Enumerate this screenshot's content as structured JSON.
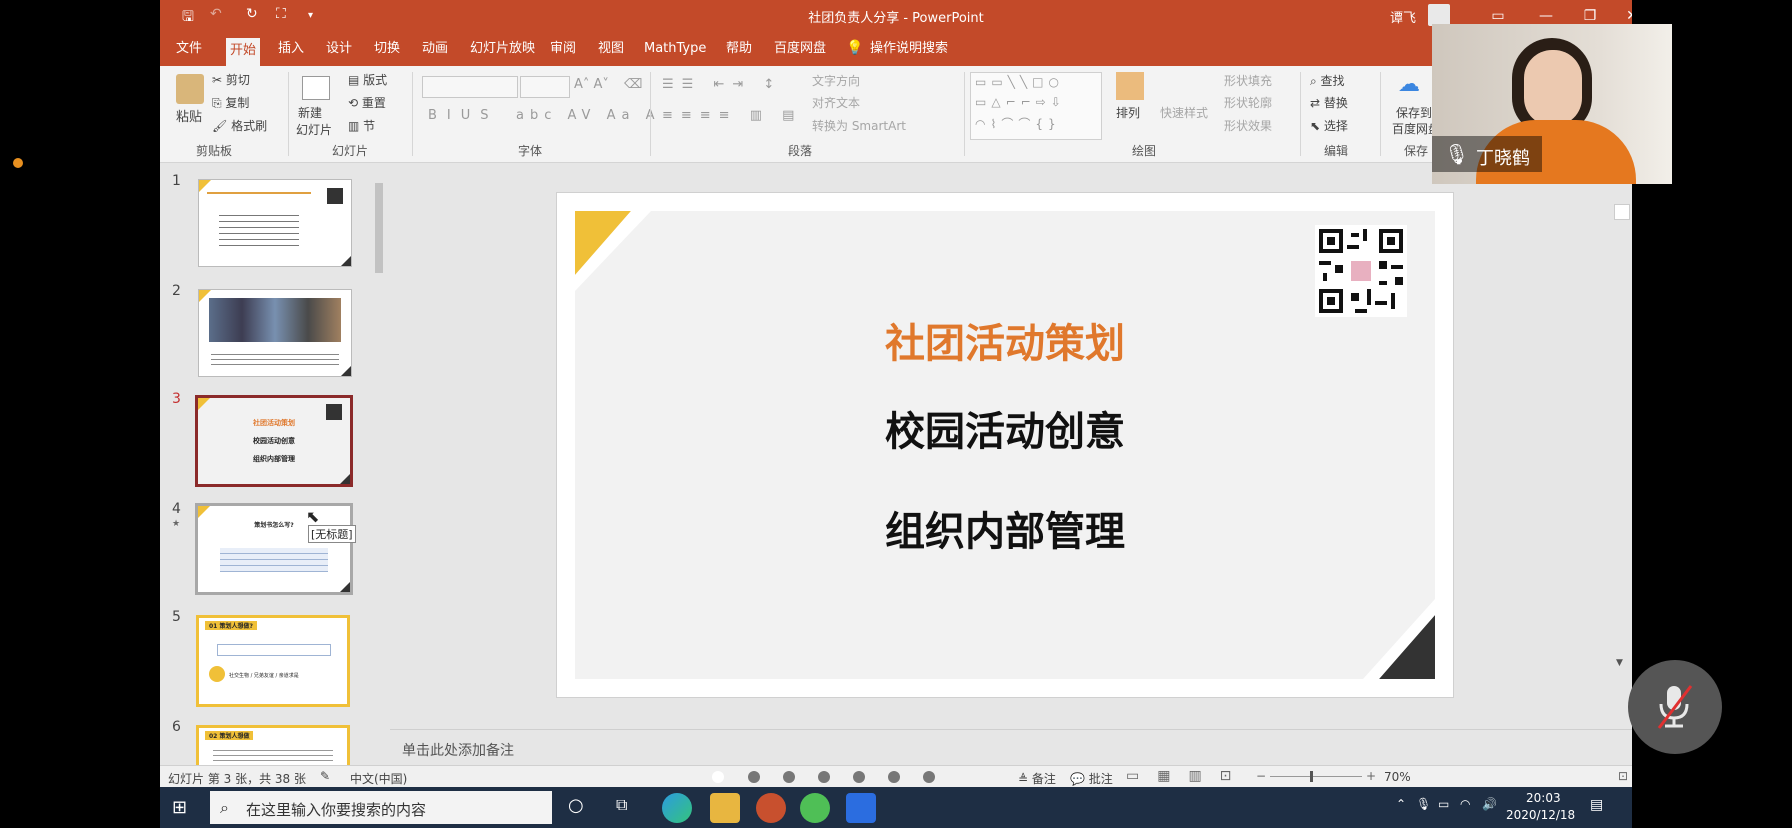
{
  "window": {
    "title": "社团负责人分享 - PowerPoint",
    "user": "谭飞"
  },
  "menu_tabs": [
    "文件",
    "开始",
    "插入",
    "设计",
    "切换",
    "动画",
    "幻灯片放映",
    "审阅",
    "视图",
    "MathType",
    "帮助",
    "百度网盘",
    "操作说明搜索"
  ],
  "ribbon": {
    "clipboard": {
      "paste": "粘贴",
      "cut": "剪切",
      "copy": "复制",
      "format_painter": "格式刷",
      "label": "剪贴板"
    },
    "slides": {
      "new_slide_1": "新建",
      "new_slide_2": "幻灯片",
      "layout": "版式",
      "reset": "重置",
      "section": "节",
      "label": "幻灯片"
    },
    "font": {
      "label": "字体"
    },
    "paragraph": {
      "text_direction": "文字方向",
      "align_text": "对齐文本",
      "smartart": "转换为 SmartArt",
      "label": "段落"
    },
    "drawing": {
      "arrange": "排列",
      "quick_styles": "快速样式",
      "shape_fill": "形状填充",
      "shape_outline": "形状轮廓",
      "shape_effects": "形状效果",
      "label": "绘图"
    },
    "editing": {
      "find": "查找",
      "replace": "替换",
      "select": "选择",
      "label": "编辑"
    },
    "save": {
      "line1": "保存到",
      "line2": "百度网盘",
      "label": "保存"
    }
  },
  "thumbnails": {
    "numbers": [
      "1",
      "2",
      "3",
      "4",
      "5",
      "6"
    ],
    "s3_lines": [
      "社团活动策划",
      "校园活动创意",
      "组织内部管理"
    ],
    "s4_title": "策划书怎么写?",
    "s4_tooltip": "[无标题]",
    "s5_badge": "01 策划人想做?",
    "s5_line": "社交生物 / 兄弟友谊 / 亲道求是",
    "s6_badge": "02 策划人想做"
  },
  "slide": {
    "line1": "社团活动策划",
    "line2": "校园活动创意",
    "line3": "组织内部管理",
    "accent_color": "#e0782c",
    "corner_color": "#f0c038"
  },
  "notes_placeholder": "单击此处添加备注",
  "status": {
    "slide_info": "幻灯片 第 3 张，共 38 张",
    "language": "中文(中国)",
    "notes": "备注",
    "comments": "批注",
    "zoom": "70%"
  },
  "taskbar": {
    "search_placeholder": "在这里输入你要搜索的内容",
    "time": "20:03",
    "date": "2020/12/18"
  },
  "camera": {
    "name": "丁晓鹤"
  }
}
